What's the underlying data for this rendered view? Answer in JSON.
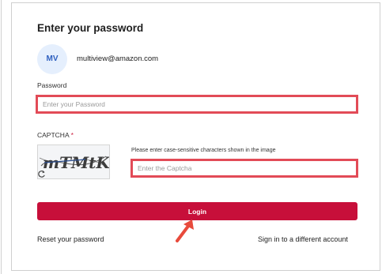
{
  "login_card": {
    "title": "Enter your password",
    "avatar_initials": "MV",
    "email": "multiview@amazon.com",
    "password": {
      "label": "Password",
      "placeholder": "Enter your Password",
      "value": ""
    },
    "captcha": {
      "label": "CAPTCHA",
      "required_marker": "*",
      "image_text": "mTMtK",
      "hint": "Please enter case-sensitive characters shown in the image",
      "placeholder": "Enter the Captcha",
      "value": ""
    },
    "login_button": "Login",
    "reset_link": "Reset your password",
    "different_account_link": "Sign in to a different account"
  },
  "icons": {
    "refresh": "refresh-icon",
    "annotation_arrow": "arrow-icon"
  },
  "colors": {
    "primary_button": "#c70f3a",
    "highlight_border": "#e24b57",
    "avatar_background": "#e5effd",
    "avatar_text": "#2d5fbf",
    "required_marker": "#cc1f3f"
  }
}
